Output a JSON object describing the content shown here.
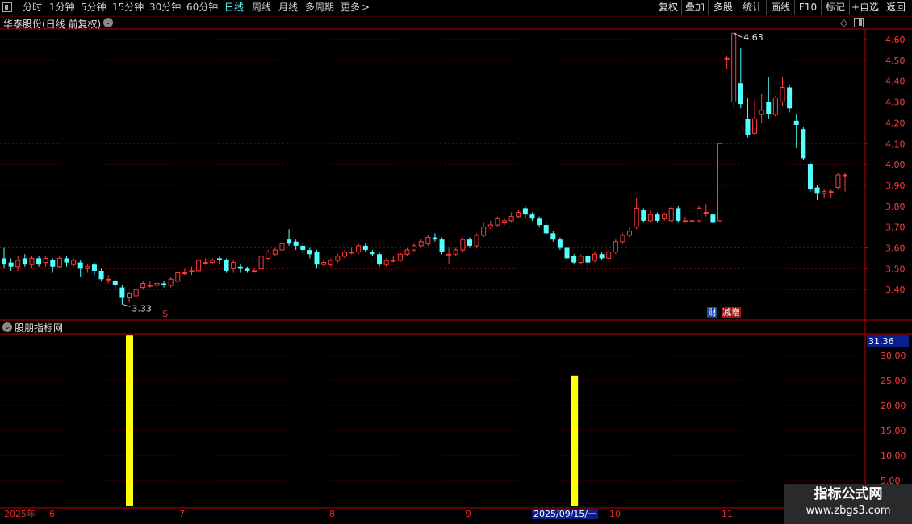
{
  "toolbar": {
    "periods": [
      "分时",
      "1分钟",
      "5分钟",
      "15分钟",
      "30分钟",
      "60分钟",
      "日线",
      "周线",
      "月线",
      "多周期",
      "更多"
    ],
    "active_period": "日线",
    "more_icon": "chevron-right-icon",
    "right_buttons": [
      "复权",
      "叠加",
      "多股",
      "统计",
      "画线",
      "F10",
      "标记",
      "+自选",
      "返回"
    ]
  },
  "main_chart": {
    "title": "华泰股份(日线 前复权)",
    "price_ticks": [
      "4.60",
      "4.50",
      "4.40",
      "4.30",
      "4.20",
      "4.10",
      "4.00",
      "3.90",
      "3.80",
      "3.70",
      "3.60",
      "3.50",
      "3.40"
    ],
    "high_label": "4.63",
    "low_label": "3.33",
    "marker_s": "S",
    "badge_cai": "财",
    "badge_jian": "减增",
    "colors": {
      "up": "#ff3c3c",
      "down": "#54ffff",
      "grid": "#7a0000",
      "axis": "#c00000"
    }
  },
  "indicator": {
    "title": "股朋指标网",
    "current_value": "31.36",
    "ticks": [
      "30.00",
      "25.00",
      "20.00",
      "15.00",
      "10.00",
      "5.00"
    ],
    "bar_color": "#ffff00"
  },
  "x_axis": {
    "labels": [
      "2025年",
      "6",
      "7",
      "8",
      "9",
      "10",
      "11"
    ],
    "cursor_date": "2025/09/15/一"
  },
  "watermark": {
    "line1": "指标公式网",
    "line2": "www.zbgs3.com"
  },
  "chart_data": [
    {
      "type": "candlestick",
      "title": "华泰股份(日线 前复权)",
      "ylim": [
        3.3,
        4.7
      ],
      "y_ticks": [
        3.4,
        3.5,
        3.6,
        3.7,
        3.8,
        3.9,
        4.0,
        4.1,
        4.2,
        4.3,
        4.4,
        4.5,
        4.6
      ],
      "annotations": {
        "max": 4.63,
        "min": 3.33
      },
      "candles": [
        {
          "o": 3.55,
          "c": 3.52,
          "h": 3.6,
          "l": 3.5
        },
        {
          "o": 3.53,
          "c": 3.51,
          "h": 3.55,
          "l": 3.49
        },
        {
          "o": 3.51,
          "c": 3.54,
          "h": 3.56,
          "l": 3.49
        },
        {
          "o": 3.55,
          "c": 3.52,
          "h": 3.57,
          "l": 3.51
        },
        {
          "o": 3.52,
          "c": 3.55,
          "h": 3.56,
          "l": 3.5
        },
        {
          "o": 3.55,
          "c": 3.52,
          "h": 3.56,
          "l": 3.51
        },
        {
          "o": 3.53,
          "c": 3.55,
          "h": 3.56,
          "l": 3.51
        },
        {
          "o": 3.54,
          "c": 3.51,
          "h": 3.55,
          "l": 3.48
        },
        {
          "o": 3.51,
          "c": 3.55,
          "h": 3.56,
          "l": 3.5
        },
        {
          "o": 3.55,
          "c": 3.53,
          "h": 3.56,
          "l": 3.51
        },
        {
          "o": 3.52,
          "c": 3.54,
          "h": 3.55,
          "l": 3.51
        },
        {
          "o": 3.53,
          "c": 3.5,
          "h": 3.54,
          "l": 3.46
        },
        {
          "o": 3.5,
          "c": 3.51,
          "h": 3.52,
          "l": 3.48
        },
        {
          "o": 3.52,
          "c": 3.49,
          "h": 3.53,
          "l": 3.47
        },
        {
          "o": 3.49,
          "c": 3.45,
          "h": 3.5,
          "l": 3.44
        },
        {
          "o": 3.45,
          "c": 3.45,
          "h": 3.47,
          "l": 3.43
        },
        {
          "o": 3.44,
          "c": 3.42,
          "h": 3.45,
          "l": 3.4
        },
        {
          "o": 3.41,
          "c": 3.36,
          "h": 3.42,
          "l": 3.33
        },
        {
          "o": 3.36,
          "c": 3.38,
          "h": 3.39,
          "l": 3.34
        },
        {
          "o": 3.37,
          "c": 3.4,
          "h": 3.41,
          "l": 3.36
        },
        {
          "o": 3.41,
          "c": 3.43,
          "h": 3.44,
          "l": 3.4
        },
        {
          "o": 3.42,
          "c": 3.42,
          "h": 3.44,
          "l": 3.41
        },
        {
          "o": 3.42,
          "c": 3.43,
          "h": 3.45,
          "l": 3.41
        },
        {
          "o": 3.43,
          "c": 3.42,
          "h": 3.44,
          "l": 3.41
        },
        {
          "o": 3.42,
          "c": 3.45,
          "h": 3.46,
          "l": 3.41
        },
        {
          "o": 3.44,
          "c": 3.48,
          "h": 3.49,
          "l": 3.43
        },
        {
          "o": 3.48,
          "c": 3.48,
          "h": 3.5,
          "l": 3.47
        },
        {
          "o": 3.49,
          "c": 3.49,
          "h": 3.51,
          "l": 3.47
        },
        {
          "o": 3.49,
          "c": 3.54,
          "h": 3.55,
          "l": 3.48
        },
        {
          "o": 3.53,
          "c": 3.53,
          "h": 3.55,
          "l": 3.52
        },
        {
          "o": 3.53,
          "c": 3.54,
          "h": 3.55,
          "l": 3.52
        },
        {
          "o": 3.55,
          "c": 3.54,
          "h": 3.56,
          "l": 3.52
        },
        {
          "o": 3.54,
          "c": 3.49,
          "h": 3.55,
          "l": 3.48
        },
        {
          "o": 3.5,
          "c": 3.53,
          "h": 3.54,
          "l": 3.48
        },
        {
          "o": 3.51,
          "c": 3.5,
          "h": 3.52,
          "l": 3.48
        },
        {
          "o": 3.5,
          "c": 3.49,
          "h": 3.51,
          "l": 3.48
        },
        {
          "o": 3.49,
          "c": 3.49,
          "h": 3.5,
          "l": 3.48
        },
        {
          "o": 3.5,
          "c": 3.56,
          "h": 3.57,
          "l": 3.49
        },
        {
          "o": 3.55,
          "c": 3.58,
          "h": 3.59,
          "l": 3.54
        },
        {
          "o": 3.57,
          "c": 3.59,
          "h": 3.6,
          "l": 3.56
        },
        {
          "o": 3.59,
          "c": 3.62,
          "h": 3.64,
          "l": 3.58
        },
        {
          "o": 3.64,
          "c": 3.62,
          "h": 3.69,
          "l": 3.61
        },
        {
          "o": 3.63,
          "c": 3.61,
          "h": 3.64,
          "l": 3.59
        },
        {
          "o": 3.61,
          "c": 3.59,
          "h": 3.62,
          "l": 3.57
        },
        {
          "o": 3.59,
          "c": 3.57,
          "h": 3.6,
          "l": 3.55
        },
        {
          "o": 3.58,
          "c": 3.52,
          "h": 3.59,
          "l": 3.5
        },
        {
          "o": 3.52,
          "c": 3.53,
          "h": 3.54,
          "l": 3.51
        },
        {
          "o": 3.52,
          "c": 3.54,
          "h": 3.55,
          "l": 3.51
        },
        {
          "o": 3.54,
          "c": 3.56,
          "h": 3.57,
          "l": 3.53
        },
        {
          "o": 3.56,
          "c": 3.58,
          "h": 3.59,
          "l": 3.55
        },
        {
          "o": 3.58,
          "c": 3.58,
          "h": 3.6,
          "l": 3.57
        },
        {
          "o": 3.58,
          "c": 3.61,
          "h": 3.62,
          "l": 3.57
        },
        {
          "o": 3.61,
          "c": 3.59,
          "h": 3.62,
          "l": 3.58
        },
        {
          "o": 3.58,
          "c": 3.57,
          "h": 3.59,
          "l": 3.56
        },
        {
          "o": 3.57,
          "c": 3.52,
          "h": 3.58,
          "l": 3.51
        },
        {
          "o": 3.52,
          "c": 3.54,
          "h": 3.55,
          "l": 3.51
        },
        {
          "o": 3.54,
          "c": 3.54,
          "h": 3.56,
          "l": 3.53
        },
        {
          "o": 3.54,
          "c": 3.57,
          "h": 3.58,
          "l": 3.53
        },
        {
          "o": 3.57,
          "c": 3.59,
          "h": 3.6,
          "l": 3.56
        },
        {
          "o": 3.59,
          "c": 3.61,
          "h": 3.62,
          "l": 3.58
        },
        {
          "o": 3.61,
          "c": 3.63,
          "h": 3.64,
          "l": 3.6
        },
        {
          "o": 3.62,
          "c": 3.65,
          "h": 3.66,
          "l": 3.61
        },
        {
          "o": 3.65,
          "c": 3.64,
          "h": 3.67,
          "l": 3.63
        },
        {
          "o": 3.64,
          "c": 3.58,
          "h": 3.65,
          "l": 3.57
        },
        {
          "o": 3.57,
          "c": 3.57,
          "h": 3.6,
          "l": 3.52
        },
        {
          "o": 3.57,
          "c": 3.59,
          "h": 3.6,
          "l": 3.56
        },
        {
          "o": 3.59,
          "c": 3.64,
          "h": 3.65,
          "l": 3.58
        },
        {
          "o": 3.64,
          "c": 3.61,
          "h": 3.65,
          "l": 3.6
        },
        {
          "o": 3.61,
          "c": 3.66,
          "h": 3.67,
          "l": 3.6
        },
        {
          "o": 3.66,
          "c": 3.7,
          "h": 3.72,
          "l": 3.65
        },
        {
          "o": 3.7,
          "c": 3.71,
          "h": 3.73,
          "l": 3.69
        },
        {
          "o": 3.71,
          "c": 3.74,
          "h": 3.75,
          "l": 3.7
        },
        {
          "o": 3.72,
          "c": 3.73,
          "h": 3.74,
          "l": 3.71
        },
        {
          "o": 3.73,
          "c": 3.75,
          "h": 3.77,
          "l": 3.72
        },
        {
          "o": 3.75,
          "c": 3.77,
          "h": 3.78,
          "l": 3.74
        },
        {
          "o": 3.79,
          "c": 3.76,
          "h": 3.8,
          "l": 3.74
        },
        {
          "o": 3.76,
          "c": 3.74,
          "h": 3.77,
          "l": 3.73
        },
        {
          "o": 3.74,
          "c": 3.71,
          "h": 3.75,
          "l": 3.7
        },
        {
          "o": 3.71,
          "c": 3.67,
          "h": 3.72,
          "l": 3.66
        },
        {
          "o": 3.67,
          "c": 3.64,
          "h": 3.68,
          "l": 3.63
        },
        {
          "o": 3.64,
          "c": 3.6,
          "h": 3.65,
          "l": 3.59
        },
        {
          "o": 3.6,
          "c": 3.55,
          "h": 3.61,
          "l": 3.52
        },
        {
          "o": 3.56,
          "c": 3.53,
          "h": 3.57,
          "l": 3.52
        },
        {
          "o": 3.53,
          "c": 3.56,
          "h": 3.57,
          "l": 3.52
        },
        {
          "o": 3.56,
          "c": 3.53,
          "h": 3.57,
          "l": 3.49
        },
        {
          "o": 3.54,
          "c": 3.57,
          "h": 3.58,
          "l": 3.53
        },
        {
          "o": 3.57,
          "c": 3.55,
          "h": 3.58,
          "l": 3.54
        },
        {
          "o": 3.55,
          "c": 3.58,
          "h": 3.59,
          "l": 3.54
        },
        {
          "o": 3.58,
          "c": 3.63,
          "h": 3.64,
          "l": 3.57
        },
        {
          "o": 3.63,
          "c": 3.66,
          "h": 3.67,
          "l": 3.62
        },
        {
          "o": 3.66,
          "c": 3.68,
          "h": 3.7,
          "l": 3.65
        },
        {
          "o": 3.7,
          "c": 3.79,
          "h": 3.84,
          "l": 3.69
        },
        {
          "o": 3.78,
          "c": 3.73,
          "h": 3.79,
          "l": 3.72
        },
        {
          "o": 3.73,
          "c": 3.76,
          "h": 3.78,
          "l": 3.72
        },
        {
          "o": 3.76,
          "c": 3.73,
          "h": 3.77,
          "l": 3.72
        },
        {
          "o": 3.74,
          "c": 3.76,
          "h": 3.77,
          "l": 3.73
        },
        {
          "o": 3.73,
          "c": 3.79,
          "h": 3.8,
          "l": 3.72
        },
        {
          "o": 3.79,
          "c": 3.73,
          "h": 3.8,
          "l": 3.72
        },
        {
          "o": 3.73,
          "c": 3.73,
          "h": 3.75,
          "l": 3.72
        },
        {
          "o": 3.73,
          "c": 3.73,
          "h": 3.74,
          "l": 3.71
        },
        {
          "o": 3.73,
          "c": 3.79,
          "h": 3.8,
          "l": 3.72
        },
        {
          "o": 3.77,
          "c": 3.77,
          "h": 3.81,
          "l": 3.75
        },
        {
          "o": 3.76,
          "c": 3.72,
          "h": 3.77,
          "l": 3.71
        },
        {
          "o": 3.73,
          "c": 4.1,
          "h": 4.1,
          "l": 3.72
        },
        {
          "o": 4.51,
          "c": 4.51,
          "h": 4.52,
          "l": 4.46
        },
        {
          "o": 4.3,
          "c": 4.63,
          "h": 4.63,
          "l": 4.27
        },
        {
          "o": 4.39,
          "c": 4.29,
          "h": 4.56,
          "l": 4.27
        },
        {
          "o": 4.22,
          "c": 4.14,
          "h": 4.32,
          "l": 4.13
        },
        {
          "o": 4.15,
          "c": 4.22,
          "h": 4.31,
          "l": 4.14
        },
        {
          "o": 4.24,
          "c": 4.26,
          "h": 4.34,
          "l": 4.2
        },
        {
          "o": 4.3,
          "c": 4.24,
          "h": 4.42,
          "l": 4.22
        },
        {
          "o": 4.24,
          "c": 4.32,
          "h": 4.33,
          "l": 4.23
        },
        {
          "o": 4.3,
          "c": 4.37,
          "h": 4.42,
          "l": 4.28
        },
        {
          "o": 4.37,
          "c": 4.27,
          "h": 4.38,
          "l": 4.25
        },
        {
          "o": 4.21,
          "c": 4.19,
          "h": 4.24,
          "l": 4.08
        },
        {
          "o": 4.17,
          "c": 4.03,
          "h": 4.18,
          "l": 4.02
        },
        {
          "o": 4.0,
          "c": 3.88,
          "h": 4.01,
          "l": 3.87
        },
        {
          "o": 3.89,
          "c": 3.86,
          "h": 3.9,
          "l": 3.83
        },
        {
          "o": 3.86,
          "c": 3.87,
          "h": 3.88,
          "l": 3.84
        },
        {
          "o": 3.87,
          "c": 3.87,
          "h": 3.88,
          "l": 3.84
        },
        {
          "o": 3.89,
          "c": 3.95,
          "h": 3.96,
          "l": 3.88
        },
        {
          "o": 3.95,
          "c": 3.95,
          "h": 3.96,
          "l": 3.87
        }
      ]
    },
    {
      "type": "bar",
      "title": "股朋指标网",
      "ylim": [
        0,
        34
      ],
      "y_ticks": [
        5,
        10,
        15,
        20,
        25,
        30
      ],
      "bars": [
        {
          "candle_index": 18,
          "value": 34
        },
        {
          "candle_index": 82,
          "value": 26
        }
      ]
    }
  ]
}
